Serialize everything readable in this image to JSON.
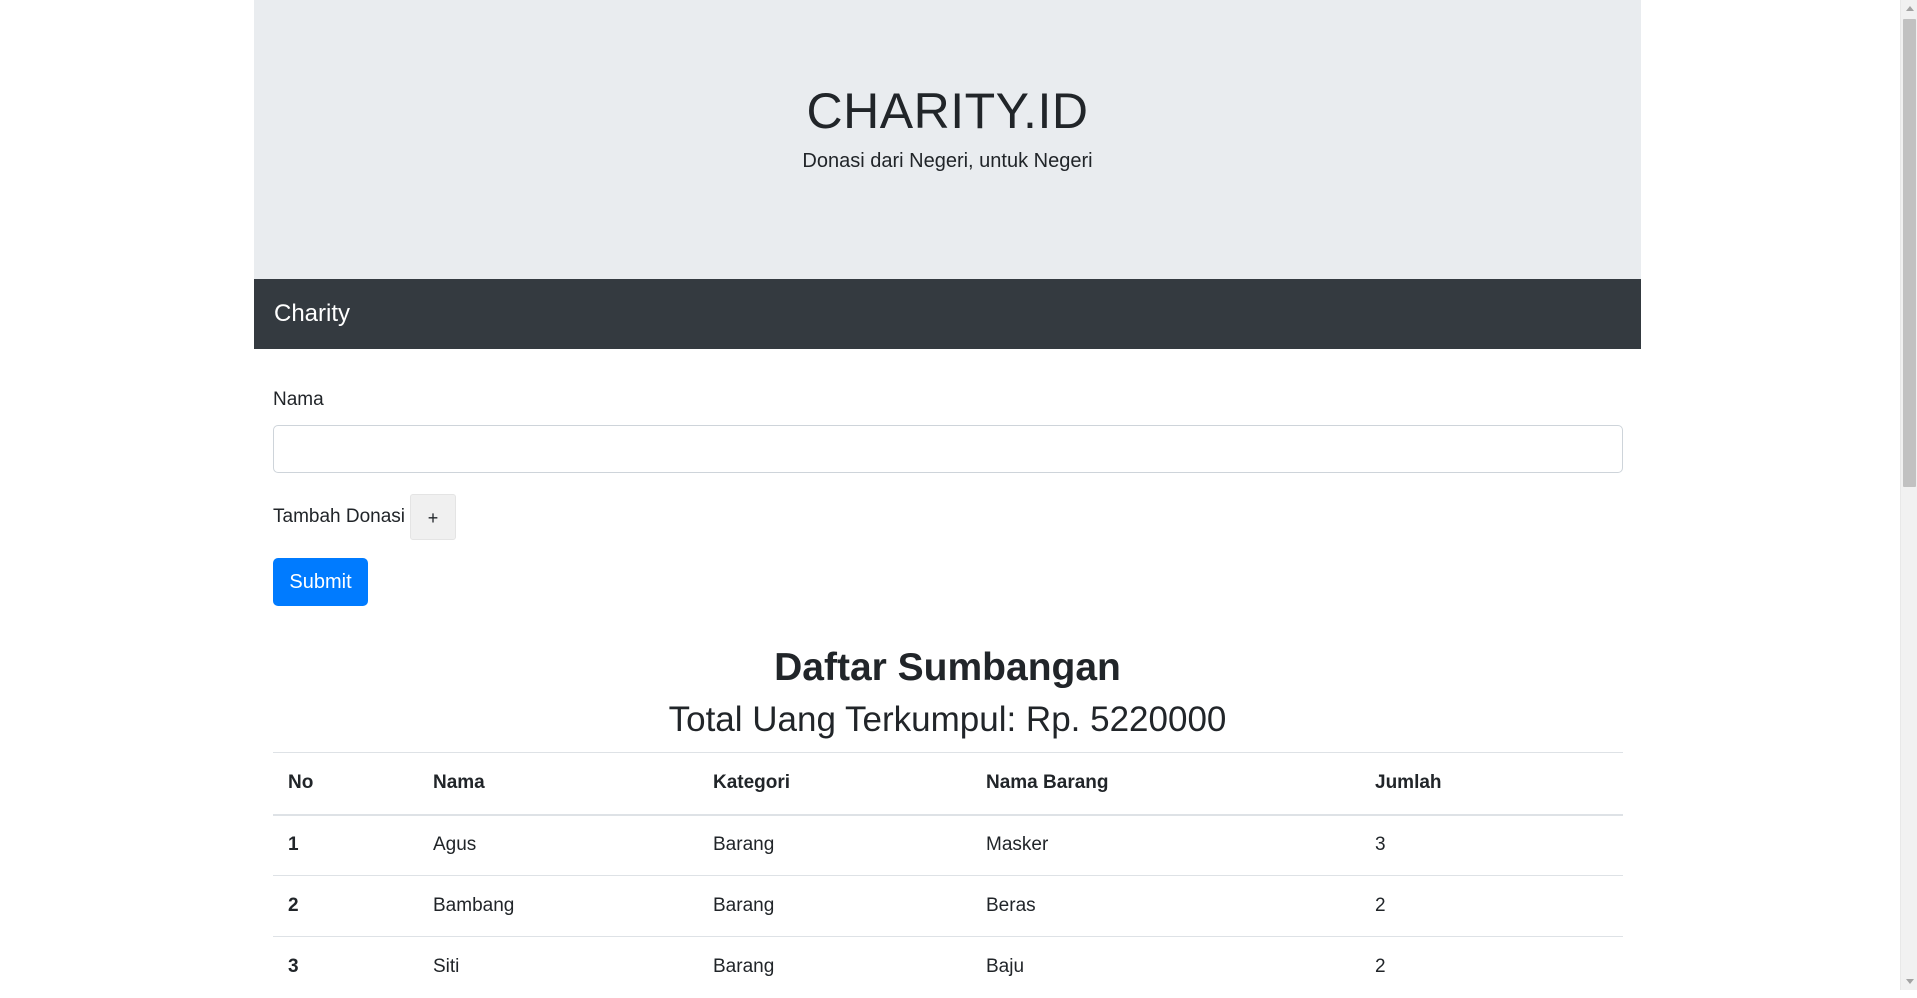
{
  "header": {
    "title": "CHARITY.ID",
    "tagline": "Donasi dari Negeri, untuk Negeri"
  },
  "navbar": {
    "brand": "Charity"
  },
  "form": {
    "name_label": "Nama",
    "name_value": "",
    "name_placeholder": "",
    "add_donation_label": "Tambah Donasi",
    "add_button_label": "+",
    "submit_label": "Submit"
  },
  "summary": {
    "heading": "Daftar Sumbangan",
    "total_text": "Total Uang Terkumpul: Rp. 5220000"
  },
  "table": {
    "headers": [
      "No",
      "Nama",
      "Kategori",
      "Nama Barang",
      "Jumlah"
    ],
    "rows": [
      [
        "1",
        "Agus",
        "Barang",
        "Masker",
        "3"
      ],
      [
        "2",
        "Bambang",
        "Barang",
        "Beras",
        "2"
      ],
      [
        "3",
        "Siti",
        "Barang",
        "Baju",
        "2"
      ]
    ]
  },
  "colors": {
    "jumbotron_bg": "#e9ecef",
    "navbar_bg": "#343a40",
    "primary": "#007bff"
  }
}
